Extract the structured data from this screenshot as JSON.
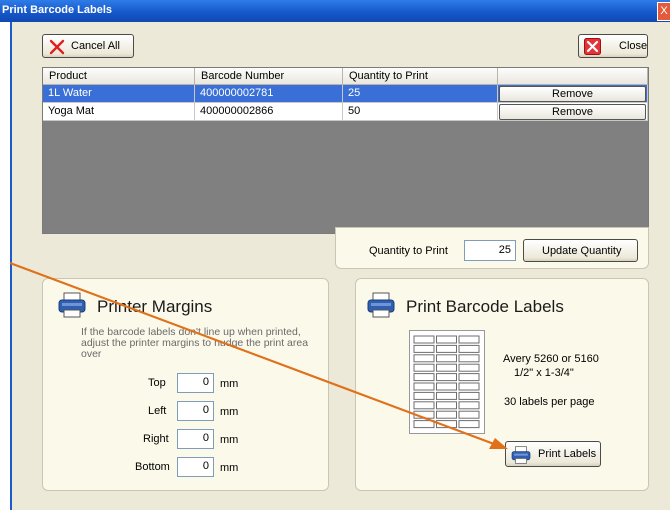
{
  "window": {
    "title": "Print Barcode Labels",
    "close_glyph": "X"
  },
  "toolbar": {
    "cancel_all_label": "Cancel All",
    "close_label": "Close"
  },
  "grid": {
    "columns": [
      "Product",
      "Barcode Number",
      "Quantity to Print",
      ""
    ],
    "rows": [
      {
        "product": "1L Water",
        "barcode": "400000002781",
        "qty": "25",
        "action": "Remove",
        "selected": true
      },
      {
        "product": "Yoga Mat",
        "barcode": "400000002866",
        "qty": "50",
        "action": "Remove",
        "selected": false
      }
    ]
  },
  "quantity": {
    "label": "Quantity to Print",
    "value": "25",
    "update_label": "Update Quantity"
  },
  "margins": {
    "title": "Printer Margins",
    "description": "If the barcode labels don't line up when printed, adjust the printer margins to nudge the print area over",
    "fields": [
      {
        "label": "Top",
        "value": "0",
        "unit": "mm"
      },
      {
        "label": "Left",
        "value": "0",
        "unit": "mm"
      },
      {
        "label": "Right",
        "value": "0",
        "unit": "mm"
      },
      {
        "label": "Bottom",
        "value": "0",
        "unit": "mm"
      }
    ]
  },
  "labels": {
    "title": "Print Barcode Labels",
    "spec_line1": "Avery 5260 or 5160",
    "spec_line2": "1/2\" x 1-3/4\"",
    "per_page": "30 labels per page",
    "print_label": "Print Labels"
  },
  "colors": {
    "accent": "#3a6fd8",
    "arrow": "#e0701a",
    "panel_bg": "#fbf9ea"
  },
  "icons": [
    "cancel-x-icon",
    "close-x-icon",
    "printer-icon"
  ]
}
